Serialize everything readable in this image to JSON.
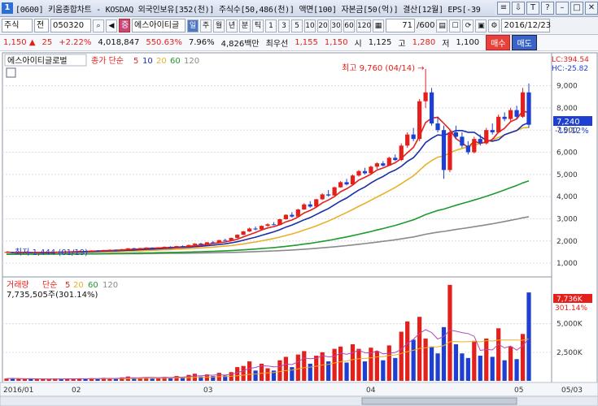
{
  "titlebar": {
    "icon_label": "1",
    "text": "[0600] 키움종합차트 - KOSDAQ 외국인보유[352(천)] 주식수[50,486(천)] 액면[100] 자본금[50(억)] 결산[12월] EPS[-39",
    "buttons": [
      "≡",
      "⇩",
      "T",
      "?",
      "–",
      "□",
      "✕"
    ]
  },
  "toolbar": {
    "market": "주식",
    "type": "전",
    "code": "050320",
    "badge": "증",
    "stock_name": "에스아이티글",
    "periods": [
      "일",
      "주",
      "월",
      "년",
      "분",
      "틱"
    ],
    "selected_period": "일",
    "intervals": [
      "1",
      "3",
      "5",
      "10",
      "20",
      "30",
      "60",
      "120"
    ],
    "count": "71",
    "total": "/600",
    "date": "2016/12/23"
  },
  "quote": {
    "price": "1,150",
    "change_arrow": "▲",
    "change": "25",
    "change_pct": "+2.22%",
    "volume": "4,018,847",
    "vol_ratio": "550.63%",
    "turnover": "7.96%",
    "trade_value": "4,826백만",
    "best_bid_label": "최우선",
    "best_ask": "1,155",
    "best_bid": "1,150",
    "open_label": "시",
    "open": "1,125",
    "high_label": "고",
    "high": "1,280",
    "low_label": "저",
    "low": "1,100",
    "buy_label": "매수",
    "sell_label": "매도"
  },
  "price_panel": {
    "legend": {
      "name": "에스아이티글로벌",
      "type": "종가 단순",
      "ma": [
        "5",
        "10",
        "20",
        "60",
        "120"
      ]
    },
    "top_right": {
      "lc": "LC:394.54",
      "hc": "HC:-25.82"
    },
    "y_ticks": [
      "9,000",
      "8,000",
      "7,000",
      "6,000",
      "5,000",
      "4,000",
      "3,000",
      "2,000",
      "1,000"
    ],
    "current_price": "7,240",
    "current_pct": "-15.12%",
    "high_annotation": "최고 9,760 (04/14) →",
    "low_annotation": "최저 1,444 (01/19)"
  },
  "volume_panel": {
    "legend": {
      "name": "거래량",
      "type": "단순",
      "ma": [
        "5",
        "20",
        "60",
        "120"
      ]
    },
    "value": "7,735,505주(301.14%)",
    "y_ticks": [
      "5,000K",
      "2,500K"
    ],
    "current_value": "7,736K",
    "current_pct": "301.14%"
  },
  "x_axis": [
    "2016/01",
    "02",
    "03",
    "04",
    "05",
    "05/03"
  ],
  "colors": {
    "up": "#e3201b",
    "down": "#1e3fd1",
    "ma5": "#e3201b",
    "ma10": "#1a2fa8",
    "ma20": "#e8b12a",
    "ma60": "#1f9a2d",
    "ma120": "#8a8a8a"
  },
  "chart_data": {
    "type": "candlestick",
    "y_range": [
      600,
      9900
    ],
    "volume_range_k": [
      0,
      8600
    ],
    "candles": [
      [
        1500,
        1520,
        1480,
        1500,
        200,
        "u"
      ],
      [
        1500,
        1510,
        1444,
        1460,
        220,
        "d"
      ],
      [
        1460,
        1490,
        1450,
        1480,
        180,
        "u"
      ],
      [
        1480,
        1500,
        1470,
        1490,
        150,
        "u"
      ],
      [
        1490,
        1500,
        1460,
        1470,
        160,
        "d"
      ],
      [
        1470,
        1490,
        1460,
        1480,
        140,
        "u"
      ],
      [
        1480,
        1500,
        1470,
        1490,
        180,
        "u"
      ],
      [
        1490,
        1510,
        1480,
        1500,
        160,
        "u"
      ],
      [
        1500,
        1520,
        1490,
        1510,
        200,
        "u"
      ],
      [
        1510,
        1520,
        1490,
        1500,
        150,
        "d"
      ],
      [
        1500,
        1530,
        1500,
        1520,
        190,
        "u"
      ],
      [
        1520,
        1540,
        1510,
        1530,
        170,
        "u"
      ],
      [
        1530,
        1560,
        1520,
        1550,
        210,
        "u"
      ],
      [
        1550,
        1560,
        1530,
        1540,
        160,
        "d"
      ],
      [
        1540,
        1580,
        1540,
        1570,
        230,
        "u"
      ],
      [
        1570,
        1590,
        1550,
        1560,
        190,
        "d"
      ],
      [
        1560,
        1600,
        1560,
        1590,
        260,
        "u"
      ],
      [
        1590,
        1620,
        1580,
        1600,
        220,
        "u"
      ],
      [
        1600,
        1620,
        1570,
        1580,
        180,
        "d"
      ],
      [
        1580,
        1640,
        1580,
        1630,
        300,
        "u"
      ],
      [
        1630,
        1680,
        1620,
        1670,
        380,
        "u"
      ],
      [
        1670,
        1690,
        1640,
        1650,
        260,
        "d"
      ],
      [
        1650,
        1690,
        1650,
        1680,
        280,
        "u"
      ],
      [
        1680,
        1720,
        1670,
        1700,
        320,
        "u"
      ],
      [
        1700,
        1710,
        1660,
        1670,
        240,
        "d"
      ],
      [
        1670,
        1720,
        1670,
        1710,
        300,
        "u"
      ],
      [
        1710,
        1750,
        1700,
        1740,
        340,
        "u"
      ],
      [
        1740,
        1760,
        1700,
        1710,
        260,
        "d"
      ],
      [
        1710,
        1780,
        1710,
        1770,
        420,
        "u"
      ],
      [
        1770,
        1800,
        1740,
        1750,
        300,
        "d"
      ],
      [
        1750,
        1830,
        1750,
        1820,
        520,
        "u"
      ],
      [
        1820,
        1900,
        1800,
        1880,
        620,
        "u"
      ],
      [
        1880,
        1920,
        1840,
        1860,
        380,
        "d"
      ],
      [
        1860,
        1950,
        1860,
        1940,
        560,
        "u"
      ],
      [
        1940,
        2000,
        1900,
        1910,
        420,
        "d"
      ],
      [
        1910,
        2050,
        1910,
        2040,
        700,
        "u"
      ],
      [
        2040,
        2100,
        2000,
        2020,
        460,
        "d"
      ],
      [
        2020,
        2150,
        2020,
        2140,
        760,
        "u"
      ],
      [
        2140,
        2300,
        2120,
        2280,
        1200,
        "u"
      ],
      [
        2280,
        2450,
        2260,
        2430,
        1300,
        "u"
      ],
      [
        2430,
        2600,
        2400,
        2560,
        1700,
        "u"
      ],
      [
        2560,
        2650,
        2480,
        2520,
        900,
        "d"
      ],
      [
        2520,
        2700,
        2510,
        2680,
        1500,
        "u"
      ],
      [
        2680,
        2800,
        2640,
        2750,
        1100,
        "u"
      ],
      [
        2750,
        2850,
        2700,
        2720,
        900,
        "d"
      ],
      [
        2720,
        3000,
        2710,
        2980,
        1800,
        "u"
      ],
      [
        2980,
        3200,
        2960,
        3180,
        2100,
        "u"
      ],
      [
        3180,
        3300,
        3050,
        3100,
        1200,
        "d"
      ],
      [
        3100,
        3450,
        3100,
        3420,
        2300,
        "u"
      ],
      [
        3420,
        3700,
        3400,
        3650,
        2600,
        "u"
      ],
      [
        3650,
        3800,
        3500,
        3550,
        1500,
        "d"
      ],
      [
        3550,
        3900,
        3540,
        3880,
        2200,
        "u"
      ],
      [
        3880,
        4150,
        3850,
        4100,
        2500,
        "u"
      ],
      [
        4100,
        4300,
        4000,
        4050,
        1700,
        "d"
      ],
      [
        4050,
        4450,
        4050,
        4420,
        2800,
        "u"
      ],
      [
        4420,
        4700,
        4400,
        4650,
        3000,
        "u"
      ],
      [
        4650,
        4800,
        4500,
        4550,
        1600,
        "d"
      ],
      [
        4550,
        5000,
        4550,
        4950,
        3200,
        "u"
      ],
      [
        4950,
        5200,
        4900,
        5150,
        2800,
        "u"
      ],
      [
        5150,
        5300,
        5000,
        5050,
        1700,
        "d"
      ],
      [
        5050,
        5400,
        5000,
        5350,
        2900,
        "u"
      ],
      [
        5350,
        5550,
        5250,
        5500,
        2600,
        "u"
      ],
      [
        5500,
        5600,
        5350,
        5400,
        1800,
        "d"
      ],
      [
        5400,
        5800,
        5380,
        5750,
        3100,
        "u"
      ],
      [
        5750,
        5900,
        5600,
        5650,
        2000,
        "d"
      ],
      [
        5650,
        6400,
        5600,
        6300,
        4300,
        "u"
      ],
      [
        6300,
        6900,
        6200,
        6800,
        5200,
        "u"
      ],
      [
        6800,
        7100,
        6500,
        6600,
        3600,
        "d"
      ],
      [
        6600,
        8400,
        6500,
        8300,
        5600,
        "u"
      ],
      [
        8300,
        9760,
        8000,
        8700,
        3700,
        "u"
      ],
      [
        8700,
        8900,
        7200,
        7300,
        3000,
        "d"
      ],
      [
        7300,
        7600,
        6900,
        7000,
        2400,
        "d"
      ],
      [
        7000,
        7200,
        4800,
        5200,
        4700,
        "d"
      ],
      [
        5200,
        7000,
        5100,
        6900,
        8400,
        "u"
      ],
      [
        6900,
        7200,
        6600,
        6700,
        3200,
        "d"
      ],
      [
        6700,
        6900,
        6200,
        6300,
        2400,
        "d"
      ],
      [
        6300,
        6500,
        5900,
        6000,
        2000,
        "d"
      ],
      [
        6000,
        6700,
        5950,
        6600,
        3500,
        "u"
      ],
      [
        6600,
        6800,
        6300,
        6400,
        2200,
        "d"
      ],
      [
        6400,
        7100,
        6350,
        7000,
        3700,
        "u"
      ],
      [
        7000,
        7300,
        6800,
        6900,
        2100,
        "d"
      ],
      [
        6900,
        7700,
        6900,
        7600,
        4600,
        "u"
      ],
      [
        7600,
        7800,
        7400,
        7500,
        1800,
        "d"
      ],
      [
        7500,
        8000,
        7400,
        7900,
        3000,
        "u"
      ],
      [
        7900,
        8100,
        7500,
        7600,
        1900,
        "d"
      ],
      [
        7600,
        8900,
        7550,
        8700,
        4100,
        "u"
      ],
      [
        8700,
        9100,
        7100,
        7240,
        7736,
        "d"
      ]
    ]
  }
}
